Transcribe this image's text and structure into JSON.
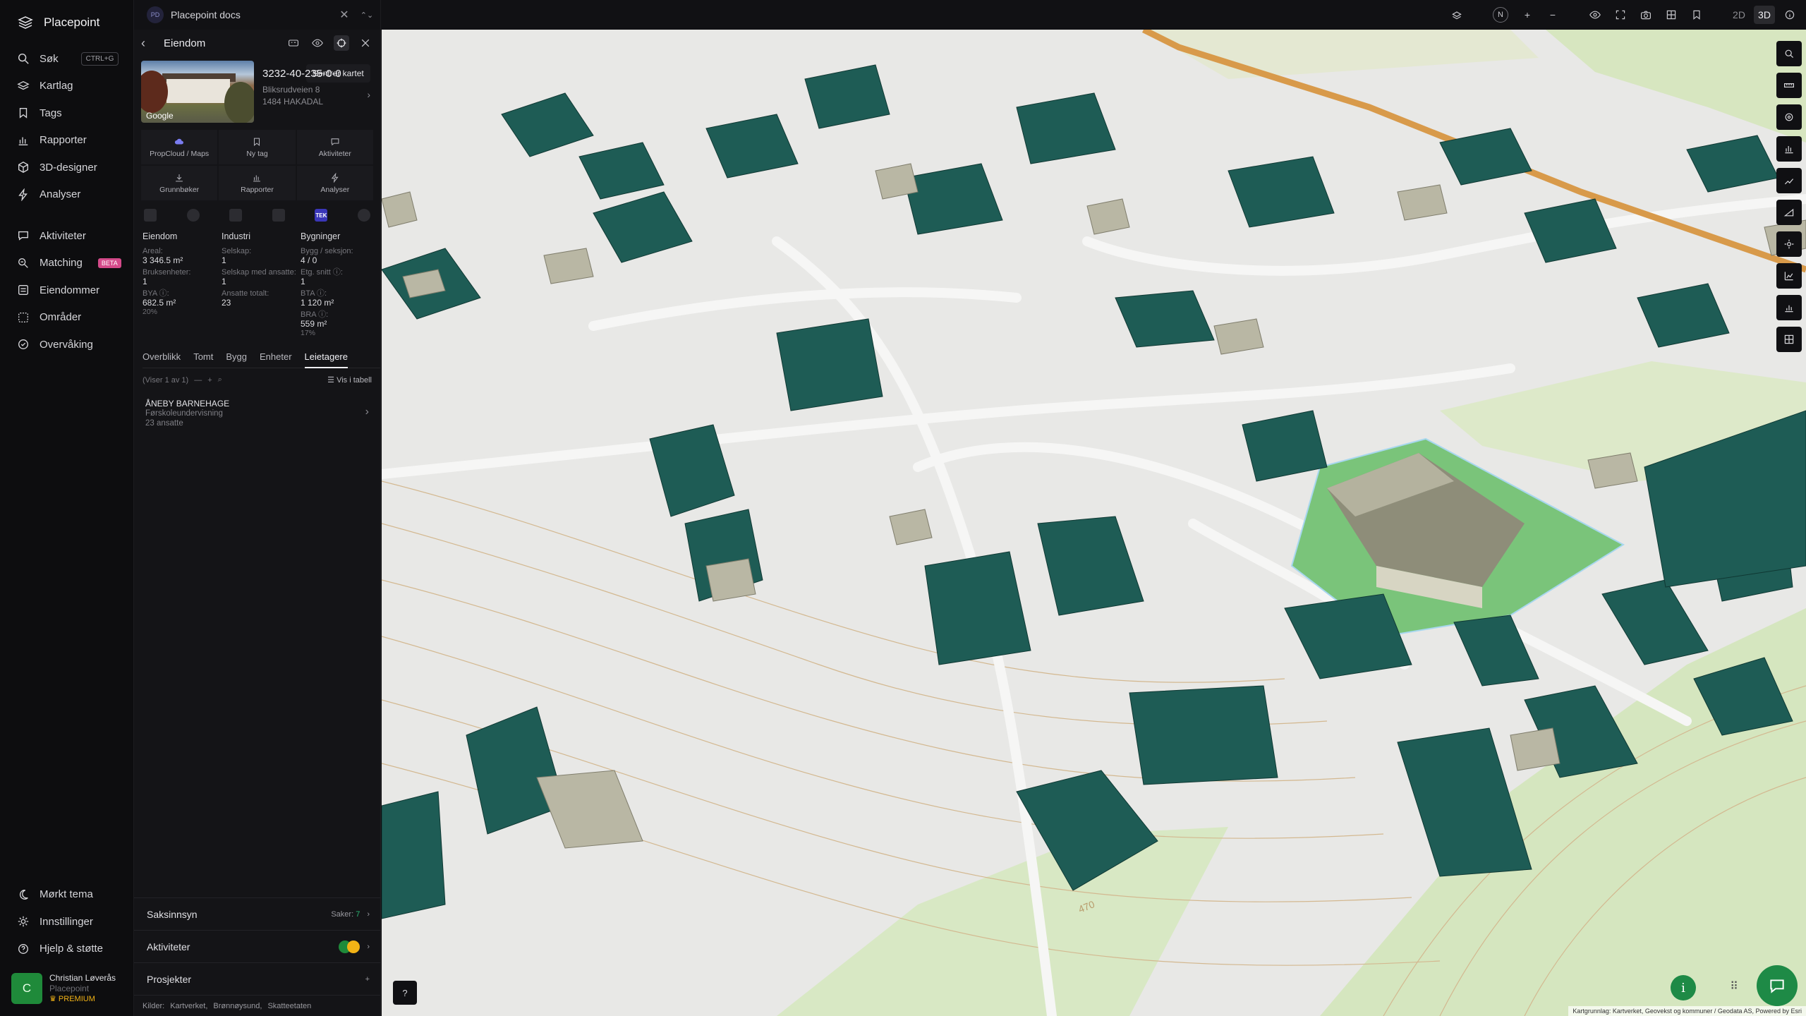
{
  "app": {
    "name": "Placepoint"
  },
  "nav": {
    "items": [
      {
        "label": "Søk",
        "icon": "search-icon",
        "shortcut": "CTRL+G"
      },
      {
        "label": "Kartlag",
        "icon": "layers-icon"
      },
      {
        "label": "Tags",
        "icon": "bookmark-icon"
      },
      {
        "label": "Rapporter",
        "icon": "bar-chart-icon"
      },
      {
        "label": "3D-designer",
        "icon": "cube-icon"
      },
      {
        "label": "Analyser",
        "icon": "bolt-icon"
      }
    ],
    "items2": [
      {
        "label": "Aktiviteter",
        "icon": "chat-icon"
      },
      {
        "label": "Matching",
        "icon": "match-icon",
        "badge": "BETA"
      },
      {
        "label": "Eiendommer",
        "icon": "list-icon"
      },
      {
        "label": "Områder",
        "icon": "area-icon"
      },
      {
        "label": "Overvåking",
        "icon": "monitor-icon"
      }
    ],
    "bottom": [
      {
        "label": "Mørkt tema",
        "icon": "moon-icon"
      },
      {
        "label": "Innstillinger",
        "icon": "gear-icon"
      },
      {
        "label": "Hjelp & støtte",
        "icon": "help-icon"
      }
    ],
    "user": {
      "initial": "C",
      "name": "Christian Løverås",
      "org": "Placepoint",
      "tier": "PREMIUM"
    }
  },
  "topbar": {
    "doc_badge": "PD",
    "doc_title": "Placepoint docs",
    "mode_2d": "2D",
    "mode_3d": "3D",
    "compass": "N"
  },
  "panel": {
    "title": "Eiendom",
    "tooltip": "Sentrer kartet",
    "property": {
      "id": "3232-40-235-0-0",
      "street": "Bliksrudveien 8",
      "postal": "1484 HAKADAL",
      "photo_tag": "Google"
    },
    "tiles": [
      {
        "label": "PropCloud / Maps",
        "icon": "cloud-icon"
      },
      {
        "label": "Ny tag",
        "icon": "bookmark-icon"
      },
      {
        "label": "Aktiviteter",
        "icon": "chat-icon"
      },
      {
        "label": "Grunnbøker",
        "icon": "download-icon"
      },
      {
        "label": "Rapporter",
        "icon": "bar-chart-icon"
      },
      {
        "label": "Analyser",
        "icon": "bolt-icon"
      }
    ],
    "source_tek": "TEK",
    "stats": {
      "eiendom": {
        "head": "Eiendom",
        "areal_label": "Areal:",
        "areal": "3 346.5 m²",
        "bruksenheter_label": "Bruksenheter:",
        "bruksenheter": "1",
        "bya_label": "BYA ⓘ:",
        "bya": "682.5 m²",
        "bya_pct": "20%"
      },
      "industri": {
        "head": "Industri",
        "selskap_label": "Selskap:",
        "selskap": "1",
        "selskap_med_label": "Selskap med ansatte:",
        "selskap_med": "1",
        "ansatte_label": "Ansatte totalt:",
        "ansatte": "23"
      },
      "bygninger": {
        "head": "Bygninger",
        "bygg_label": "Bygg / seksjon:",
        "bygg": "4 / 0",
        "etg_label": "Etg. snitt ⓘ:",
        "etg": "1",
        "bta_label": "BTA ⓘ:",
        "bta": "1 120 m²",
        "bra_label": "BRA ⓘ:",
        "bra": "559 m²",
        "bra_pct": "17%"
      }
    },
    "tabs": [
      "Overblikk",
      "Tomt",
      "Bygg",
      "Enheter",
      "Leietagere"
    ],
    "active_tab": "Leietagere",
    "subbar": {
      "showing": "(Viser 1 av 1)",
      "table_label": "Vis i tabell"
    },
    "tenant": {
      "name": "ÅNEBY BARNEHAGE",
      "industry": "Førskoleundervisning",
      "employees": "23 ansatte"
    },
    "sections": [
      {
        "label": "Saksinnsyn",
        "right_label": "Saker:",
        "right_value": "7"
      },
      {
        "label": "Aktiviteter"
      },
      {
        "label": "Prosjekter",
        "action": "+"
      }
    ],
    "sources_label": "Kilder:",
    "sources": [
      "Kartverket,",
      "Brønnøysund,",
      "Skatteetaten"
    ]
  },
  "map": {
    "attribution": "Kartgrunnlag: Kartverket, Geovekst og kommuner / Geodata AS, Powered by Esri",
    "help": "?",
    "info": "i",
    "contour_label": "470",
    "colors": {
      "building": "#1e5c55",
      "building_beige": "#b9b7a4",
      "field": "#7ac47a",
      "grass": "#cfe3b5"
    }
  }
}
